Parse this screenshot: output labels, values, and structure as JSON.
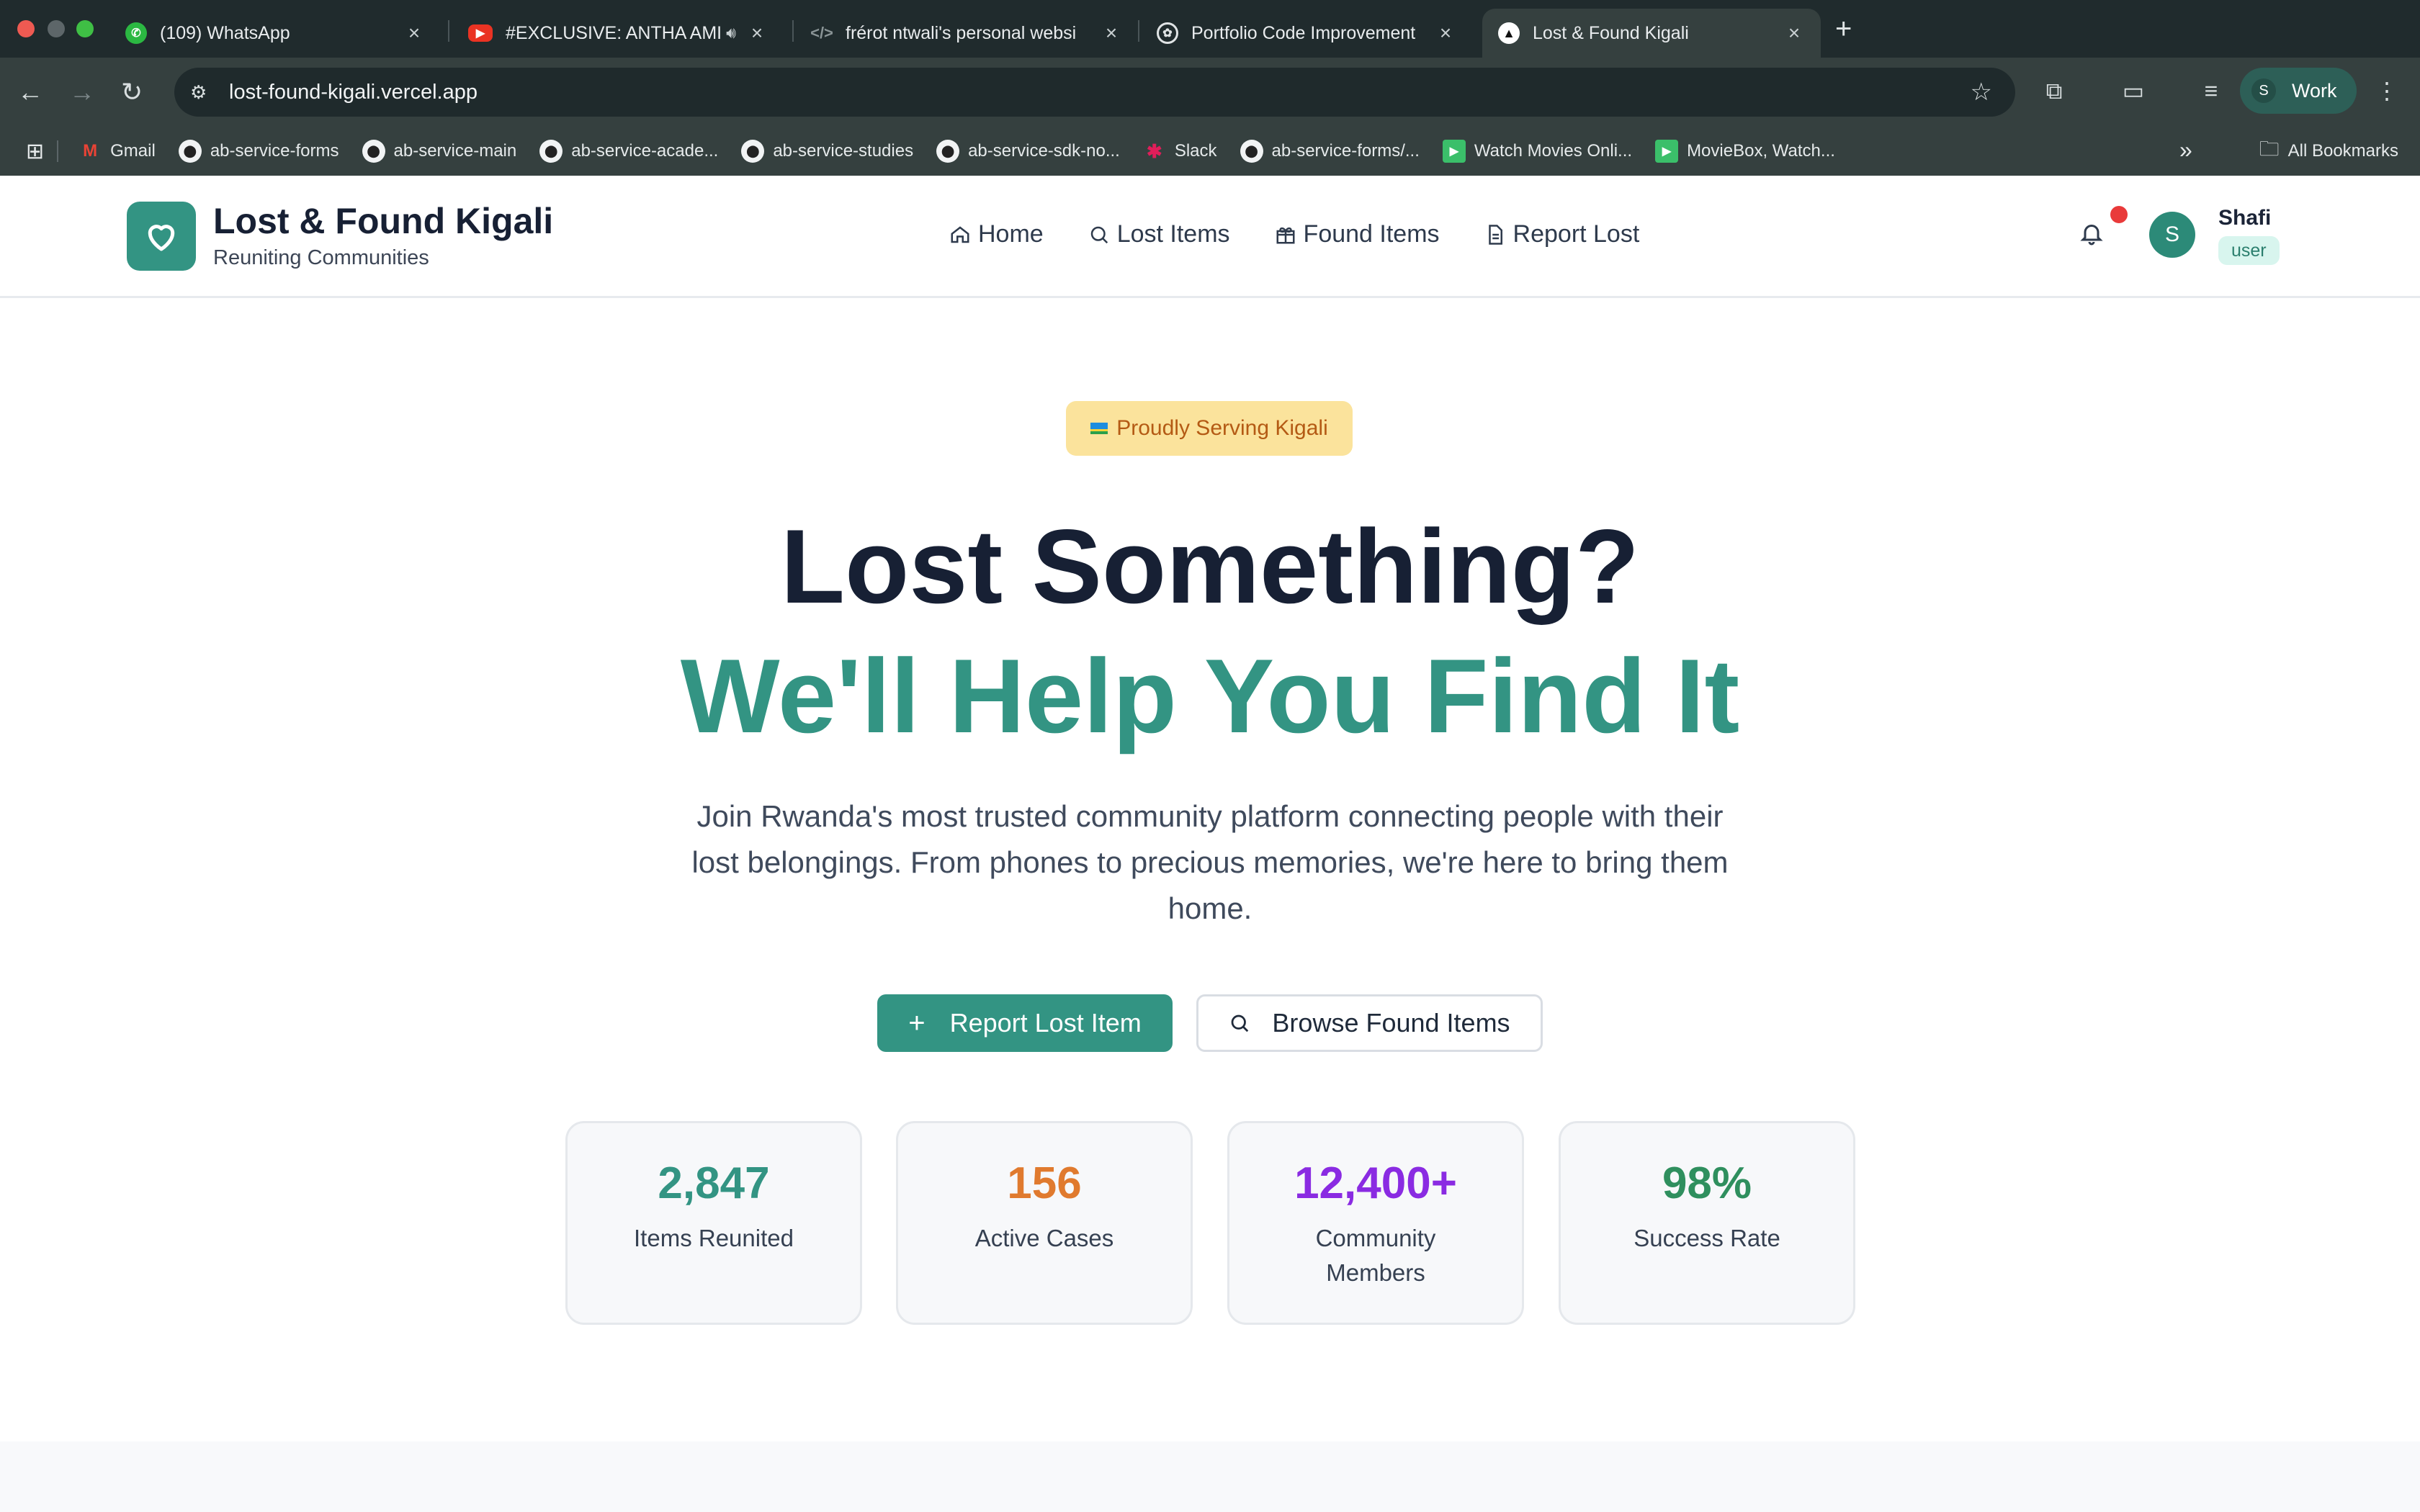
{
  "browser": {
    "tabs": [
      {
        "title": "(109) WhatsApp",
        "icon": "whatsapp-icon"
      },
      {
        "title": "#EXCLUSIVE: ANTHA AMI",
        "icon": "youtube-icon"
      },
      {
        "title": "frérot ntwali's personal websi",
        "icon": "code-icon"
      },
      {
        "title": "Portfolio Code Improvement",
        "icon": "openai-icon"
      },
      {
        "title": "Lost & Found Kigali",
        "icon": "vercel-icon"
      }
    ],
    "url": "lost-found-kigali.vercel.app",
    "profile_label": "Work",
    "profile_initial": "S",
    "bookmarks": [
      {
        "label": "Gmail",
        "icon": "gmail-icon"
      },
      {
        "label": "ab-service-forms",
        "icon": "github-icon"
      },
      {
        "label": "ab-service-main",
        "icon": "github-icon"
      },
      {
        "label": "ab-service-acade...",
        "icon": "github-icon"
      },
      {
        "label": "ab-service-studies",
        "icon": "github-icon"
      },
      {
        "label": "ab-service-sdk-no...",
        "icon": "github-icon"
      },
      {
        "label": "Slack",
        "icon": "slack-icon"
      },
      {
        "label": "ab-service-forms/...",
        "icon": "github-icon"
      },
      {
        "label": "Watch Movies Onli...",
        "icon": "play-icon"
      },
      {
        "label": "MovieBox, Watch...",
        "icon": "play-icon"
      }
    ],
    "all_bookmarks": "All Bookmarks"
  },
  "site": {
    "brand_title": "Lost & Found Kigali",
    "brand_subtitle": "Reuniting Communities",
    "nav": [
      {
        "label": "Home",
        "icon": "home-icon"
      },
      {
        "label": "Lost Items",
        "icon": "search-icon"
      },
      {
        "label": "Found Items",
        "icon": "gift-icon"
      },
      {
        "label": "Report Lost",
        "icon": "document-icon"
      }
    ],
    "user": {
      "initial": "S",
      "name": "Shafi",
      "role": "user"
    }
  },
  "hero": {
    "badge": "Proudly Serving Kigali",
    "headline_1": "Lost Something?",
    "headline_2": "We'll Help You Find It",
    "lead": "Join Rwanda's most trusted community platform connecting people with their lost belongings. From phones to precious memories, we're here to bring them home.",
    "primary_cta": "Report Lost Item",
    "secondary_cta": "Browse Found Items"
  },
  "stats": [
    {
      "value": "2,847",
      "label": "Items Reunited",
      "color": "#339483"
    },
    {
      "value": "156",
      "label": "Active Cases",
      "color": "#e07a2e"
    },
    {
      "value": "12,400+",
      "label": "Community Members",
      "color": "#8a2be2"
    },
    {
      "value": "98%",
      "label": "Success Rate",
      "color": "#2f8f5e"
    }
  ],
  "colors": {
    "brand": "#339483",
    "header_dark": "#202b2d",
    "badge_bg": "#fbe39c"
  }
}
